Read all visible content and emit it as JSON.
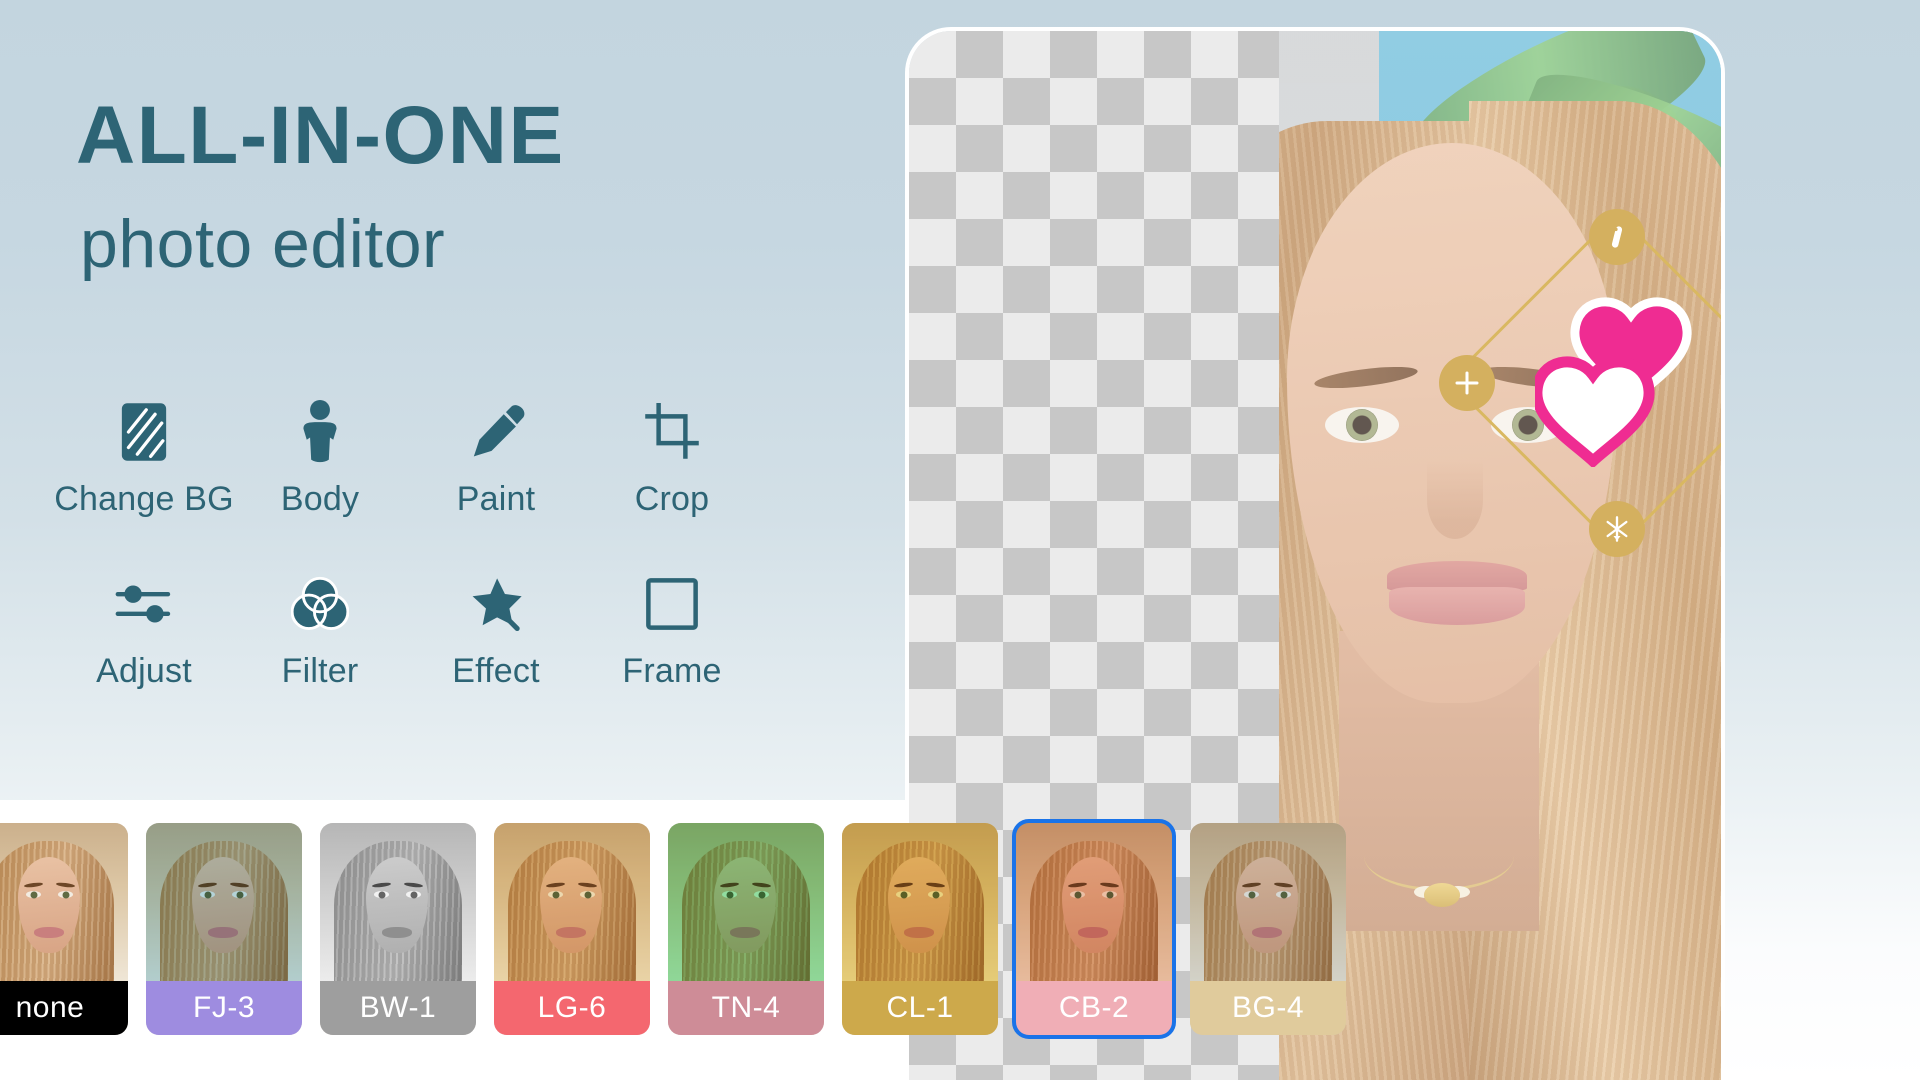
{
  "promo": {
    "headline": "ALL-IN-ONE",
    "subheadline": "photo editor",
    "text_color": "#2d6475"
  },
  "tools": [
    {
      "label": "Change BG",
      "icon": "change-background-icon"
    },
    {
      "label": "Body",
      "icon": "body-icon"
    },
    {
      "label": "Paint",
      "icon": "paint-pencil-icon"
    },
    {
      "label": "Crop",
      "icon": "crop-icon"
    },
    {
      "label": "Adjust",
      "icon": "adjust-sliders-icon"
    },
    {
      "label": "Filter",
      "icon": "filter-circles-icon"
    },
    {
      "label": "Effect",
      "icon": "effect-magic-wand-icon"
    },
    {
      "label": "Frame",
      "icon": "frame-square-icon"
    }
  ],
  "canvas": {
    "sticker": {
      "name": "double-heart-sticker",
      "color_primary": "#ef2c92",
      "color_secondary": "#ffffff",
      "frame_color": "#d9b861"
    },
    "handles": [
      {
        "name": "edit-handle",
        "icon": "pen-icon"
      },
      {
        "name": "add-handle",
        "icon": "plus-icon"
      },
      {
        "name": "rotate-handle",
        "icon": "rotate-icon"
      },
      {
        "name": "resize-handle",
        "icon": "resize-icon"
      }
    ],
    "transparency_checkerboard": true,
    "before_after_split": true
  },
  "filters": {
    "selected": "CB-2",
    "selection_color": "#1a73e8",
    "items": [
      {
        "label": "none",
        "label_bg": "#000000",
        "tint": "rgba(0,0,0,0)",
        "selected": false
      },
      {
        "label": "FJ-3",
        "label_bg": "#9e8ce0",
        "tint": "rgba(110,195,230,0.45)",
        "selected": false
      },
      {
        "label": "BW-1",
        "label_bg": "#9e9e9e",
        "tint": "grayscale",
        "selected": false
      },
      {
        "label": "LG-6",
        "label_bg": "#f4676f",
        "tint": "rgba(240,205,120,0.42)",
        "selected": false
      },
      {
        "label": "TN-4",
        "label_bg": "#ce8c97",
        "tint": "rgba(70,225,120,0.55)",
        "selected": false
      },
      {
        "label": "CL-1",
        "label_bg": "#cda94b",
        "tint": "rgba(235,200,40,0.52)",
        "selected": false
      },
      {
        "label": "CB-2",
        "label_bg": "#f0aeb6",
        "tint": "rgba(235,140,90,0.42)",
        "selected": true
      },
      {
        "label": "BG-4",
        "label_bg": "#e0cb9c",
        "tint": "rgba(200,215,225,0.55)",
        "selected": false
      }
    ]
  },
  "background": {
    "gradient_top": "#c3d5df",
    "gradient_bottom": "#ffffff"
  }
}
